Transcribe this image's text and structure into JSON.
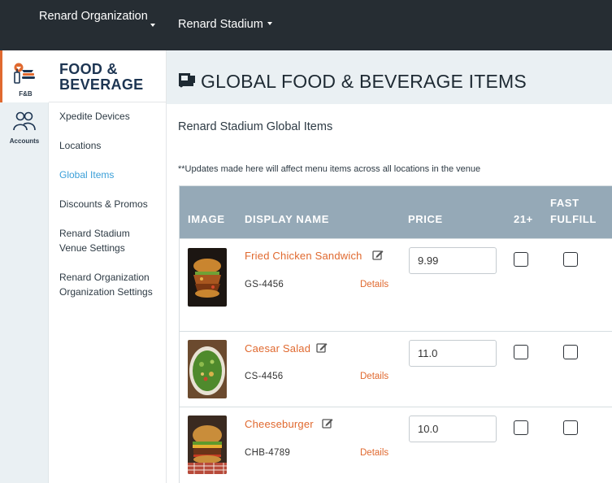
{
  "topbar": {
    "organization": "Renard Organization",
    "venue": "Renard Stadium"
  },
  "rail": {
    "fnb_label": "F&B",
    "accounts_label": "Accounts"
  },
  "sidebar": {
    "title_line1": "FOOD &",
    "title_line2": "BEVERAGE",
    "items": [
      {
        "label": "Xpedite Devices"
      },
      {
        "label": "Locations"
      },
      {
        "label": "Global Items",
        "active": true
      },
      {
        "label": "Discounts & Promos"
      },
      {
        "label": "Renard Stadium Venue Settings"
      },
      {
        "label": "Renard Organization Organization Settings"
      }
    ]
  },
  "page": {
    "title": "GLOBAL FOOD & BEVERAGE ITEMS",
    "subtitle": "Renard Stadium Global Items",
    "note": "**Updates made here will affect menu items across all locations in the venue"
  },
  "table": {
    "headers": {
      "image": "IMAGE",
      "display_name": "DISPLAY NAME",
      "price": "PRICE",
      "age": "21+",
      "fast_fulfill_line1": "FAST",
      "fast_fulfill_line2": "FULFILL"
    },
    "details_label": "Details",
    "rows": [
      {
        "name": "Fried Chicken Sandwich",
        "sku": "GS-4456",
        "price": "9.99",
        "age_21": false,
        "fast_fulfill": false
      },
      {
        "name": "Caesar Salad",
        "sku": "CS-4456",
        "price": "11.0",
        "age_21": false,
        "fast_fulfill": false
      },
      {
        "name": "Cheeseburger",
        "sku": "CHB-4789",
        "price": "10.0",
        "age_21": false,
        "fast_fulfill": false
      }
    ]
  },
  "colors": {
    "topbar": "#262d33",
    "accent": "#e0692f",
    "link_active": "#3a9fd8",
    "table_header": "#95a9b7",
    "header_band": "#eaf0f3",
    "title_navy": "#1d3552"
  }
}
